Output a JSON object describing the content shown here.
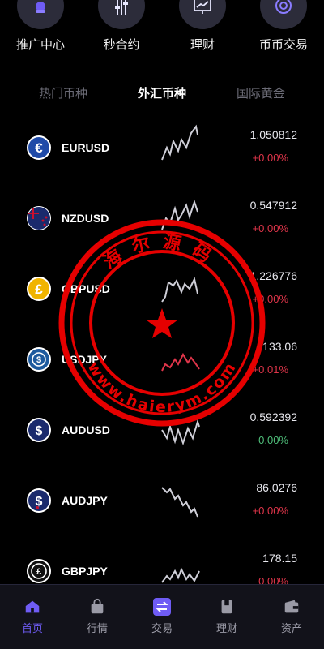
{
  "quick_actions": [
    {
      "label": "推广中心",
      "icon": "promotion-icon"
    },
    {
      "label": "秒合约",
      "icon": "contract-icon"
    },
    {
      "label": "理财",
      "icon": "finance-icon"
    },
    {
      "label": "币币交易",
      "icon": "coin-trade-icon"
    }
  ],
  "tabs": [
    {
      "label": "热门币种",
      "active": false
    },
    {
      "label": "外汇币种",
      "active": true
    },
    {
      "label": "国际黄金",
      "active": false
    }
  ],
  "markets": [
    {
      "symbol": "EURUSD",
      "price": "1.050812",
      "change": "+0.00%",
      "trend": "up"
    },
    {
      "symbol": "NZDUSD",
      "price": "0.547912",
      "change": "+0.00%",
      "trend": "up"
    },
    {
      "symbol": "GBPUSD",
      "price": "1.226776",
      "change": "+0.00%",
      "trend": "up"
    },
    {
      "symbol": "USDJPY",
      "price": "133.06",
      "change": "+0.01%",
      "trend": "up"
    },
    {
      "symbol": "AUDUSD",
      "price": "0.592392",
      "change": "-0.00%",
      "trend": "flat"
    },
    {
      "symbol": "AUDJPY",
      "price": "86.0276",
      "change": "+0.00%",
      "trend": "up"
    },
    {
      "symbol": "GBPJPY",
      "price": "178.15",
      "change": "0.00%",
      "trend": "up"
    }
  ],
  "watermark": {
    "text": "海尔源码",
    "url": "www.haierym.com",
    "color": "#e60000"
  },
  "bottom_nav": [
    {
      "label": "首页",
      "icon": "home-icon",
      "active": true
    },
    {
      "label": "行情",
      "icon": "market-bag-icon",
      "active": false
    },
    {
      "label": "交易",
      "icon": "exchange-icon",
      "active": false
    },
    {
      "label": "理财",
      "icon": "wealth-icon",
      "active": false
    },
    {
      "label": "资产",
      "icon": "wallet-icon",
      "active": false
    }
  ],
  "colors": {
    "accent": "#6f5cf5",
    "up": "#e0354a",
    "down": "#4fbf7a",
    "background": "#000000"
  }
}
